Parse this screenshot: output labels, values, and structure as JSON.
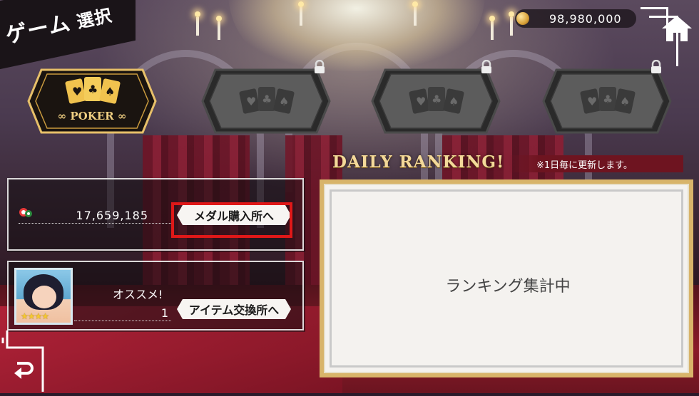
{
  "header": {
    "title_part1": "ゲーム",
    "title_part2": "選択",
    "coin_value": "98,980,000",
    "home_icon": "home-icon"
  },
  "games": [
    {
      "label": "∞ POKER ∞",
      "active": true,
      "locked": false,
      "icon": "playing-cards-icon"
    },
    {
      "label": "",
      "active": false,
      "locked": true,
      "icon": "playing-cards-icon"
    },
    {
      "label": "",
      "active": false,
      "locked": true,
      "icon": "playing-cards-icon"
    },
    {
      "label": "",
      "active": false,
      "locked": true,
      "icon": "playing-cards-icon"
    }
  ],
  "ranking": {
    "title": "DAILY RANKING!",
    "note": "※1日毎に更新します。",
    "status": "ランキング集計中"
  },
  "medal": {
    "value": "17,659,185",
    "button_label": "メダル購入所へ",
    "icon": "medal-chips-icon"
  },
  "item": {
    "label": "オススメ!",
    "count": "1",
    "button_label": "アイテム交換所へ",
    "stars": "★★★★"
  },
  "colors": {
    "gold": "#d8b46a",
    "highlight_red": "#e01818",
    "ranking_title": "#f3d99a"
  }
}
